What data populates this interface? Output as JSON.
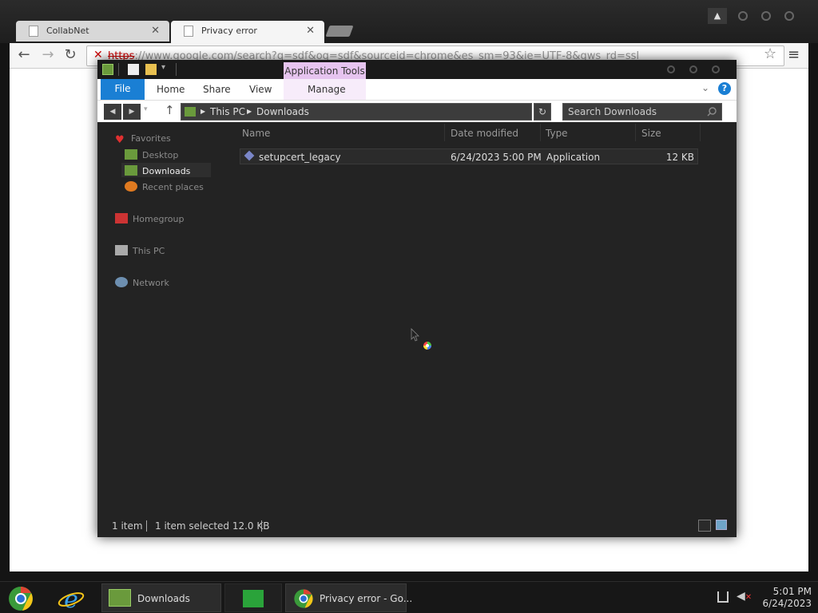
{
  "browser": {
    "tabs": [
      {
        "label": "CollabNet",
        "active": false
      },
      {
        "label": "Privacy error",
        "active": true
      }
    ],
    "url_scheme": "https",
    "url_rest": "://www.google.com/search?q=sdf&oq=sdf&sourceid=chrome&es_sm=93&ie=UTF-8&gws_rd=ssl"
  },
  "explorer": {
    "contextual_tab": "Application Tools",
    "ribbon_tabs": {
      "file": "File",
      "home": "Home",
      "share": "Share",
      "view": "View",
      "manage": "Manage"
    },
    "breadcrumb": [
      "This PC",
      "Downloads"
    ],
    "search_placeholder": "Search Downloads",
    "nav": {
      "favorites": "Favorites",
      "desktop": "Desktop",
      "downloads": "Downloads",
      "recent": "Recent places",
      "homegroup": "Homegroup",
      "thispc": "This PC",
      "network": "Network"
    },
    "columns": {
      "name": "Name",
      "date": "Date modified",
      "type": "Type",
      "size": "Size"
    },
    "files": [
      {
        "name": "setupcert_legacy",
        "date": "6/24/2023 5:00 PM",
        "type": "Application",
        "size": "12 KB"
      }
    ],
    "status": {
      "count": "1 item",
      "selected": "1 item selected  12.0 KB"
    }
  },
  "taskbar": {
    "downloads": "Downloads",
    "chrome": "Privacy error - Go...",
    "time": "5:01 PM",
    "date": "6/24/2023"
  },
  "colors": {
    "ribbon_blue": "#1a7fd4",
    "contextual_tab": "#e6c4ef",
    "url_error": "#cc0000"
  }
}
